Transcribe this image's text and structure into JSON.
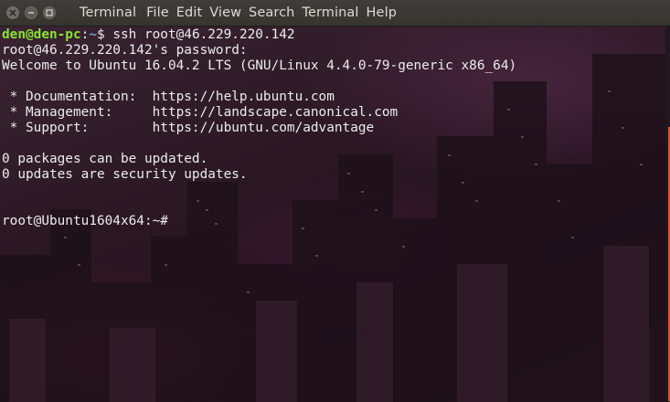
{
  "window": {
    "controls": [
      "close-icon",
      "minimize-icon",
      "maximize-icon"
    ]
  },
  "menubar": {
    "app_title": "Terminal",
    "items": [
      "File",
      "Edit",
      "View",
      "Search",
      "Terminal",
      "Help"
    ]
  },
  "terminal": {
    "prompt1": {
      "user_host": "den@den-pc",
      "sep": ":",
      "path": "~",
      "symbol": "$",
      "command": " ssh root@46.229.220.142"
    },
    "lines": [
      "root@46.229.220.142's password:",
      "Welcome to Ubuntu 16.04.2 LTS (GNU/Linux 4.4.0-79-generic x86_64)",
      "",
      " * Documentation:  https://help.ubuntu.com",
      " * Management:     https://landscape.canonical.com",
      " * Support:        https://ubuntu.com/advantage",
      "",
      "0 packages can be updated.",
      "0 updates are security updates.",
      "",
      ""
    ],
    "prompt2": "root@Ubuntu1604x64:~#"
  },
  "colors": {
    "prompt_user": "#8ae234",
    "prompt_path": "#729fcf",
    "text": "#ececec",
    "scroll_thumb": "#e95420"
  }
}
